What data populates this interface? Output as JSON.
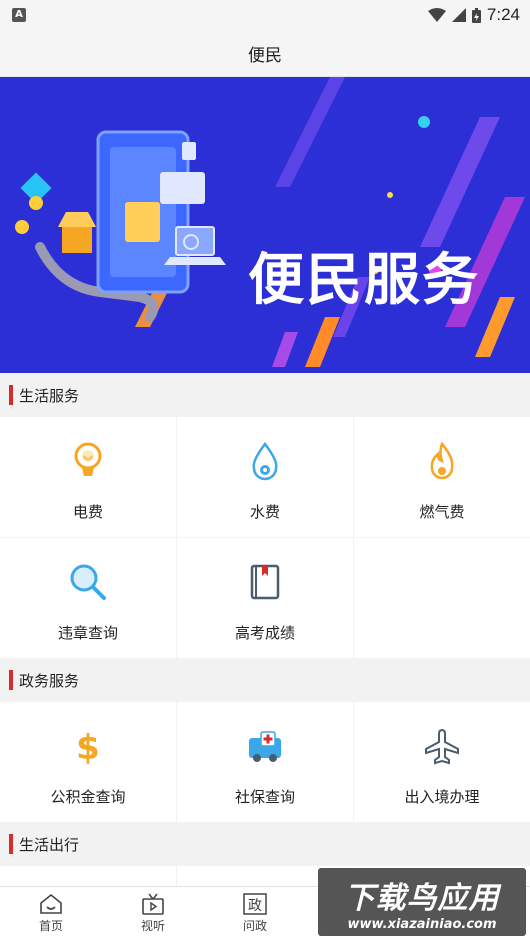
{
  "status": {
    "time": "7:24",
    "app_badge": "A"
  },
  "header": {
    "title": "便民"
  },
  "banner": {
    "text": "便民服务"
  },
  "sections": [
    {
      "title": "生活服务",
      "items": [
        {
          "label": "电费",
          "icon": "lightbulb-icon"
        },
        {
          "label": "水费",
          "icon": "water-drop-icon"
        },
        {
          "label": "燃气费",
          "icon": "flame-icon"
        },
        {
          "label": "违章查询",
          "icon": "magnifier-icon"
        },
        {
          "label": "高考成绩",
          "icon": "book-icon"
        }
      ]
    },
    {
      "title": "政务服务",
      "items": [
        {
          "label": "公积金查询",
          "icon": "dollar-icon"
        },
        {
          "label": "社保查询",
          "icon": "ambulance-icon"
        },
        {
          "label": "出入境办理",
          "icon": "airplane-icon"
        }
      ]
    },
    {
      "title": "生活出行"
    }
  ],
  "nav": [
    {
      "label": "首页",
      "icon": "home-icon"
    },
    {
      "label": "视听",
      "icon": "tv-icon"
    },
    {
      "label": "问政",
      "icon": "zheng-icon",
      "glyph": "政"
    }
  ],
  "watermark": {
    "big": "下载鸟应用",
    "small": "www.xiazainiao.com"
  },
  "colors": {
    "accent": "#d62b2b",
    "banner_bg": "#2c2fd6",
    "icon_orange": "#f5a623",
    "icon_blue": "#3aa7e8"
  }
}
